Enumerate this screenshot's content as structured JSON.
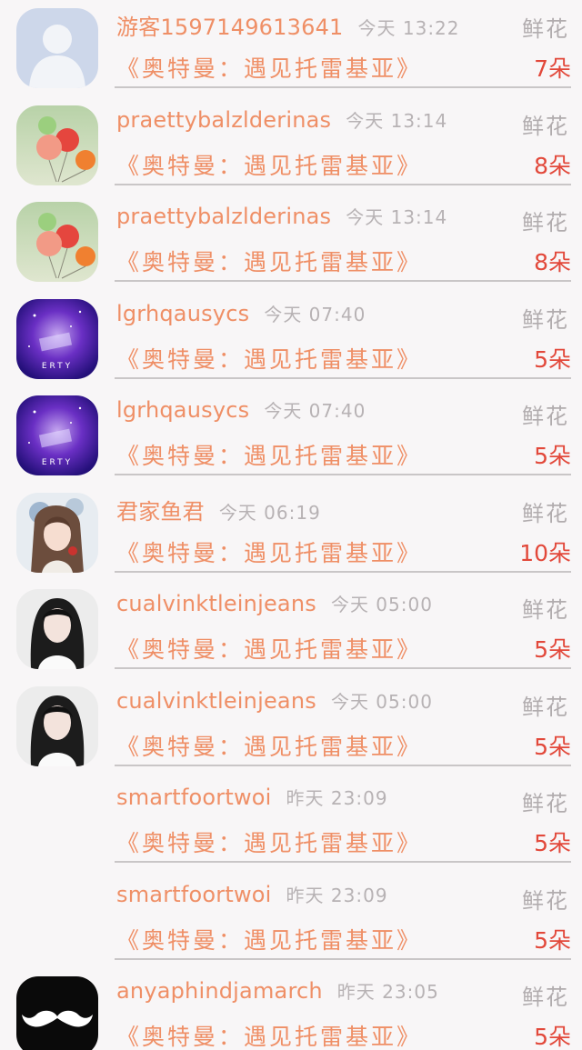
{
  "entries": [
    {
      "avatar": "default-user-avatar",
      "name": "游客1597149613641",
      "time": "今天 13:22",
      "gift": "鲜花",
      "title": "《奥特曼：遇见托雷基亚》",
      "count": "7朵"
    },
    {
      "avatar": "balloons-avatar",
      "name": "praettybalzlderinas",
      "time": "今天 13:14",
      "gift": "鲜花",
      "title": "《奥特曼：遇见托雷基亚》",
      "count": "8朵"
    },
    {
      "avatar": "balloons-avatar",
      "name": "praettybalzlderinas",
      "time": "今天 13:14",
      "gift": "鲜花",
      "title": "《奥特曼：遇见托雷基亚》",
      "count": "8朵"
    },
    {
      "avatar": "galaxy-keyboard-avatar",
      "name": "lgrhqausycs",
      "time": "今天 07:40",
      "gift": "鲜花",
      "title": "《奥特曼：遇见托雷基亚》",
      "count": "5朵"
    },
    {
      "avatar": "galaxy-keyboard-avatar",
      "name": "lgrhqausycs",
      "time": "今天 07:40",
      "gift": "鲜花",
      "title": "《奥特曼：遇见托雷基亚》",
      "count": "5朵"
    },
    {
      "avatar": "anime-girl-avatar",
      "name": "君家鱼君",
      "time": "今天 06:19",
      "gift": "鲜花",
      "title": "《奥特曼：遇见托雷基亚》",
      "count": "10朵"
    },
    {
      "avatar": "girl-photo-avatar",
      "name": "cualvinktleinjeans",
      "time": "今天 05:00",
      "gift": "鲜花",
      "title": "《奥特曼：遇见托雷基亚》",
      "count": "5朵"
    },
    {
      "avatar": "girl-photo-avatar",
      "name": "cualvinktleinjeans",
      "time": "今天 05:00",
      "gift": "鲜花",
      "title": "《奥特曼：遇见托雷基亚》",
      "count": "5朵"
    },
    {
      "avatar": "none",
      "name": "smartfoortwoi",
      "time": "昨天 23:09",
      "gift": "鲜花",
      "title": "《奥特曼：遇见托雷基亚》",
      "count": "5朵"
    },
    {
      "avatar": "none",
      "name": "smartfoortwoi",
      "time": "昨天 23:09",
      "gift": "鲜花",
      "title": "《奥特曼：遇见托雷基亚》",
      "count": "5朵"
    },
    {
      "avatar": "mustache-avatar",
      "name": "anyaphindjamarch",
      "time": "昨天 23:05",
      "gift": "鲜花",
      "title": "《奥特曼：遇见托雷基亚》",
      "count": "5朵"
    }
  ],
  "colors": {
    "name": "#ef8f66",
    "count": "#e2483a",
    "muted": "#b1acae",
    "background": "#f8f6f7"
  }
}
